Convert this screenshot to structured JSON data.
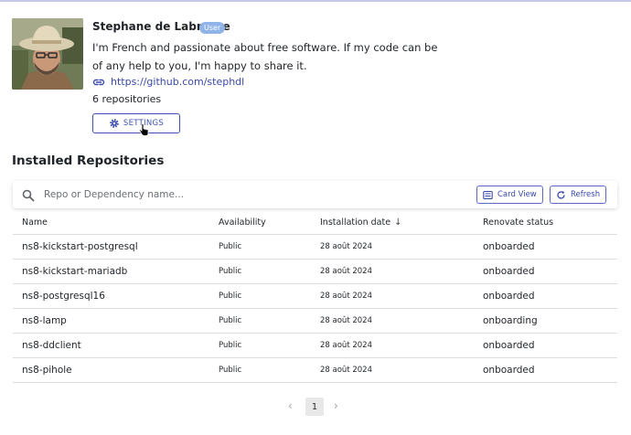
{
  "profile": {
    "name": "Stephane de Labrusse",
    "badge": "User",
    "bio": "I'm French and passionate about free software. If my code can be of any help to you, I'm happy to share it.",
    "link": "https://github.com/stephdl",
    "repo_count": "6 repositories",
    "settings_label": "SETTINGS",
    "avatar_icon": "user-photo"
  },
  "section": {
    "title": "Installed Repositories"
  },
  "search": {
    "placeholder": "Repo or Dependency name...",
    "card_view_label": "Card View",
    "refresh_label": "Refresh"
  },
  "table": {
    "headers": {
      "name": "Name",
      "availability": "Availability",
      "installation_date": "Installation date",
      "renovate_status": "Renovate status"
    },
    "rows": [
      {
        "name": "ns8-kickstart-postgresql",
        "availability": "Public",
        "date": "28 août 2024",
        "status": "onboarded"
      },
      {
        "name": "ns8-kickstart-mariadb",
        "availability": "Public",
        "date": "28 août 2024",
        "status": "onboarded"
      },
      {
        "name": "ns8-postgresql16",
        "availability": "Public",
        "date": "28 août 2024",
        "status": "onboarded"
      },
      {
        "name": "ns8-lamp",
        "availability": "Public",
        "date": "28 août 2024",
        "status": "onboarding"
      },
      {
        "name": "ns8-ddclient",
        "availability": "Public",
        "date": "28 août 2024",
        "status": "onboarded"
      },
      {
        "name": "ns8-pihole",
        "availability": "Public",
        "date": "28 août 2024",
        "status": "onboarded"
      }
    ]
  },
  "pagination": {
    "current_page": "1",
    "prev_symbol": "‹",
    "next_symbol": "›"
  },
  "colors": {
    "accent": "#3f51b5",
    "link": "#3949ab",
    "badge_bg": "#90b4e8"
  }
}
